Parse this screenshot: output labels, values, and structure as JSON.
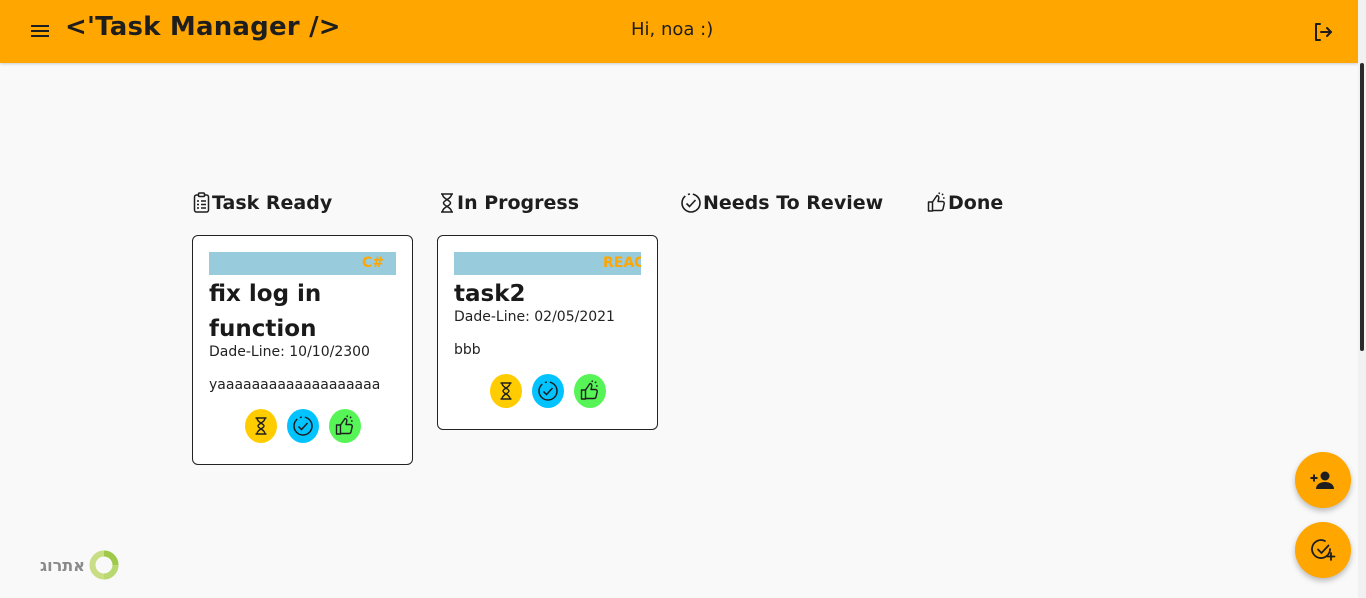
{
  "header": {
    "menu_icon": "hamburger-menu-icon",
    "title": "<'Task Manager />",
    "greeting": "Hi, noa :)",
    "logout_icon": "logout-icon",
    "background_color": "#ffa600"
  },
  "columns": [
    {
      "label": "Task Ready",
      "icon": "clipboard-list-icon"
    },
    {
      "label": "In Progress",
      "icon": "hourglass-icon"
    },
    {
      "label": "Needs To Review",
      "icon": "dashed-check-circle-icon"
    },
    {
      "label": "Done",
      "icon": "thumbs-up-icon"
    }
  ],
  "tasks": [
    {
      "column": "Task Ready",
      "tag": "C#",
      "title": "fix log in function",
      "deadline": "Dade-Line: 10/10/2300",
      "description": "yaaaaaaaaaaaaaaaaaaa",
      "actions": [
        "hourglass-icon",
        "dashed-check-circle-icon",
        "thumbs-up-icon"
      ]
    },
    {
      "column": "In Progress",
      "tag": "REACT",
      "title": "task2",
      "deadline": "Dade-Line: 02/05/2021",
      "description": "bbb",
      "actions": [
        "hourglass-icon",
        "dashed-check-circle-icon",
        "thumbs-up-icon"
      ]
    }
  ],
  "fabs": [
    {
      "icon": "add-user-icon"
    },
    {
      "icon": "add-task-icon"
    }
  ],
  "brand": {
    "text": "אתרוג",
    "icon": "ring-logo-icon"
  },
  "colors": {
    "accent": "#ffa600",
    "tag_band": "#98cbdb",
    "in_progress": "#ffcc00",
    "review": "#00c3ff",
    "done": "#56f456"
  }
}
